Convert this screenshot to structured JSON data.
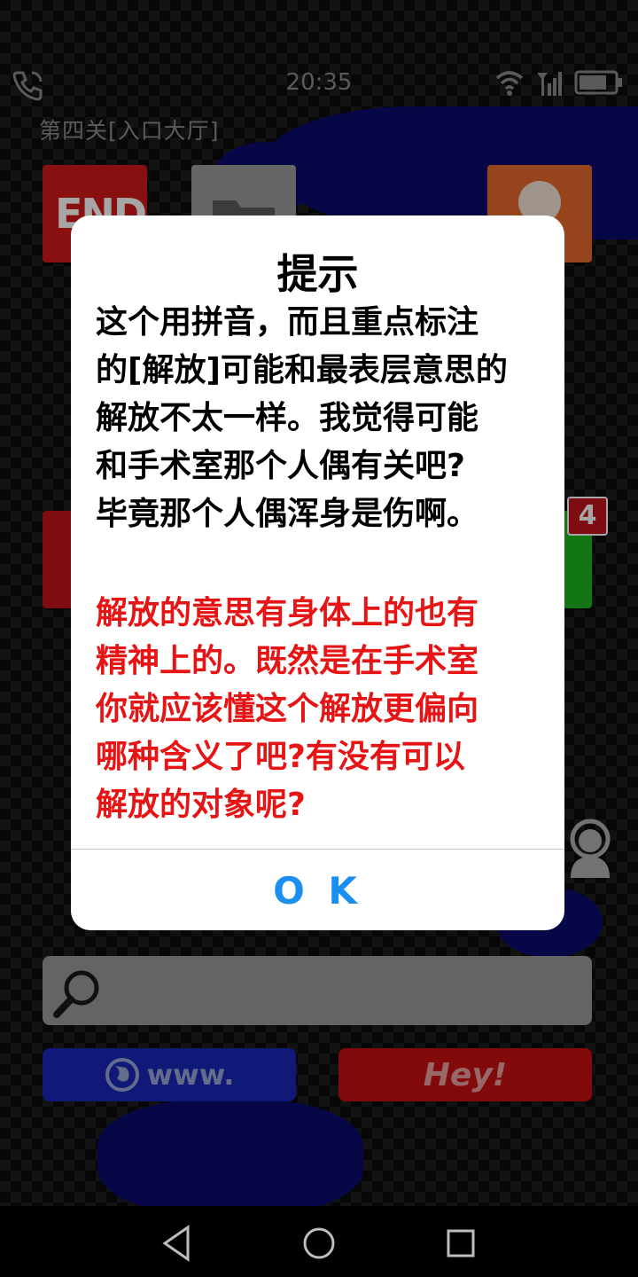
{
  "status_bar": {
    "time": "20:35"
  },
  "level_title": "第四关[入口大厅]",
  "tiles": {
    "end_label": "END",
    "badge_count": "4"
  },
  "buttons": {
    "www_label": "www.",
    "hey_label": "Hey!"
  },
  "dialog": {
    "title": "提示",
    "body": "这个用拼音，而且重点标注\n的[解放]可能和最表层意思的\n解放不太一样。我觉得可能\n和手术室那个人偶有关吧?\n毕竟那个人偶浑身是伤啊。",
    "hint": "解放的意思有身体上的也有\n精神上的。既然是在手术室\n你就应该懂这个解放更偏向\n哪种含义了吧?有没有可以\n解放的对象呢?",
    "ok_label": "O K"
  },
  "colors": {
    "hint_text": "#e61414",
    "ok_button": "#1a8ff0"
  }
}
